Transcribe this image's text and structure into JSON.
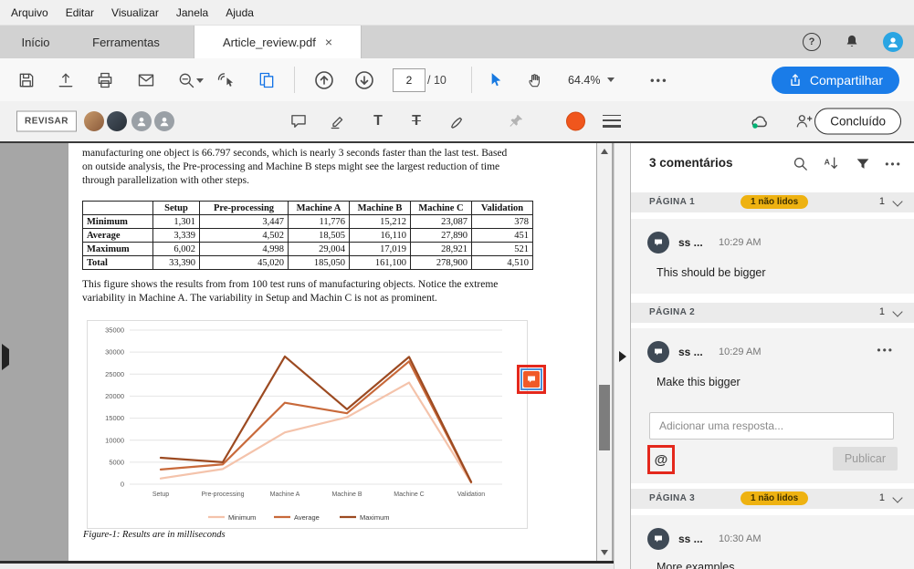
{
  "menubar": {
    "items": [
      {
        "label": "Arquivo"
      },
      {
        "label": "Editar"
      },
      {
        "label": "Visualizar"
      },
      {
        "label": "Janela"
      },
      {
        "label": "Ajuda"
      }
    ]
  },
  "tabbar": {
    "tabs": [
      {
        "label": "Início"
      },
      {
        "label": "Ferramentas"
      },
      {
        "label": "Article_review.pdf"
      }
    ],
    "close_glyph": "×"
  },
  "toolbar": {
    "page_current": "2",
    "page_total": "/ 10",
    "zoom_level": "64.4%",
    "more_glyph": "•••",
    "share_label": "Compartilhar"
  },
  "reviewbar": {
    "revisar_label": "REVISAR",
    "done_label": "Concluído"
  },
  "document": {
    "paragraph1": "manufacturing one object is 66.797 seconds, which is nearly 3 seconds faster than the last test. Based on outside analysis, the Pre-processing and Machine B steps might see the largest reduction of time through parallelization with other steps.",
    "table": {
      "headers": [
        "",
        "Setup",
        "Pre-processing",
        "Machine A",
        "Machine B",
        "Machine C",
        "Validation"
      ],
      "rows": [
        {
          "label": "Minimum",
          "values": [
            "1,301",
            "3,447",
            "11,776",
            "15,212",
            "23,087",
            "378"
          ]
        },
        {
          "label": "Average",
          "values": [
            "3,339",
            "4,502",
            "18,505",
            "16,110",
            "27,890",
            "451"
          ]
        },
        {
          "label": "Maximum",
          "values": [
            "6,002",
            "4,998",
            "29,004",
            "17,019",
            "28,921",
            "521"
          ]
        },
        {
          "label": "Total",
          "values": [
            "33,390",
            "45,020",
            "185,050",
            "161,100",
            "278,900",
            "4,510"
          ]
        }
      ]
    },
    "paragraph2": "This figure shows the results from from 100 test runs of manufacturing objects. Notice the extreme variability in Machine A. The variability in Setup and Machin C is not as prominent.",
    "figure_caption": "Figure-1: Results are in milliseconds"
  },
  "chart_data": {
    "type": "line",
    "categories": [
      "Setup",
      "Pre-processing",
      "Machine A",
      "Machine B",
      "Machine C",
      "Validation"
    ],
    "series": [
      {
        "name": "Minimum",
        "color": "#f4c3ab",
        "values": [
          1301,
          3447,
          11776,
          15212,
          23087,
          378
        ]
      },
      {
        "name": "Average",
        "color": "#c8693a",
        "values": [
          3339,
          4502,
          18505,
          16110,
          27890,
          451
        ]
      },
      {
        "name": "Maximum",
        "color": "#9c4a21",
        "values": [
          6002,
          4998,
          29004,
          17019,
          28921,
          521
        ]
      }
    ],
    "title": "",
    "xlabel": "",
    "ylabel": "",
    "ylim": [
      0,
      35000
    ],
    "ytick_step": 5000,
    "grid": true,
    "legend_position": "bottom"
  },
  "comments": {
    "header": "3 comentários",
    "more_glyph": "•••",
    "reply_placeholder": "Adicionar uma resposta...",
    "publish_label": "Publicar",
    "mention_symbol": "@",
    "sections": [
      {
        "title": "PÁGINA 1",
        "badge": "1 não lidos",
        "count": "1",
        "comments": [
          {
            "author": "ss ...",
            "time": "10:29 AM",
            "text": "This should be bigger"
          }
        ]
      },
      {
        "title": "PÁGINA 2",
        "count": "1",
        "comments": [
          {
            "author": "ss ...",
            "time": "10:29 AM",
            "text": "Make this bigger"
          }
        ]
      },
      {
        "title": "PÁGINA 3",
        "badge": "1 não lidos",
        "count": "1",
        "comments": [
          {
            "author": "ss ...",
            "time": "10:30 AM",
            "text": "More examples"
          }
        ]
      }
    ]
  }
}
